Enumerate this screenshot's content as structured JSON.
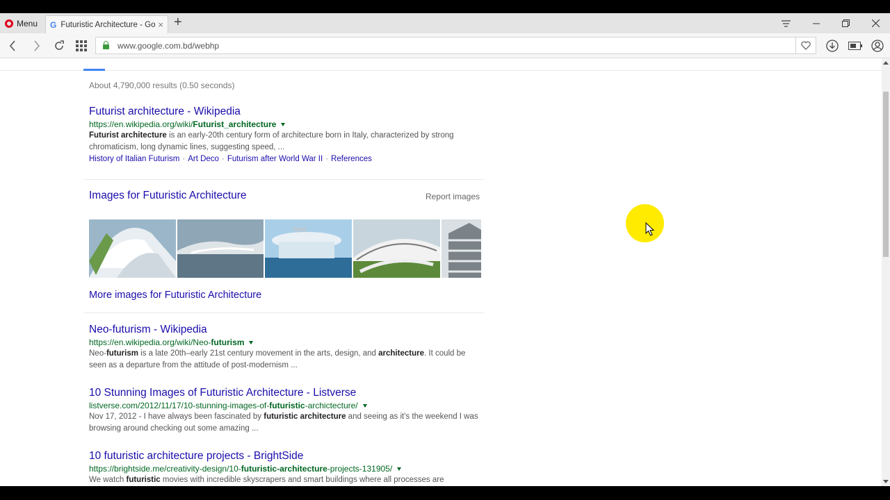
{
  "browser": {
    "menu_label": "Menu",
    "tab_title": "Futuristic Architecture - Go",
    "tab_favicon": "G",
    "tab_close": "×",
    "new_tab": "+",
    "url": "www.google.com.bd/webhp"
  },
  "stats": "About 4,790,000 results (0.50 seconds)",
  "results": [
    {
      "title": "Futurist architecture - Wikipedia",
      "url_pre": "https://en.wikipedia.org/wiki/",
      "url_bold": "Futurist_architecture",
      "url_post": "",
      "snip_bold1": "Futurist architecture",
      "snip1": " is an early-20th century form of architecture born in Italy, characterized by strong chromaticism, long dynamic lines, suggesting speed, ...",
      "sitelinks": [
        "History of Italian Futurism",
        "Art Deco",
        "Futurism after World War II",
        "References"
      ]
    },
    {
      "title": "Neo-futurism - Wikipedia",
      "url_pre": "https://en.wikipedia.org/wiki/Neo-",
      "url_bold": "futurism",
      "url_post": "",
      "snip_a": "Neo-",
      "snip_b": "futurism",
      "snip_c": " is a late 20th–early 21st century movement in the arts, design, and ",
      "snip_d": "architecture",
      "snip_e": ". It could be seen as a departure from the attitude of post-modernism ..."
    },
    {
      "title": "10 Stunning Images of Futuristic Architecture - Listverse",
      "url_pre": "listverse.com/2012/11/17/10-stunning-images-of-",
      "url_bold": "futuristic",
      "url_post": "-archictecture/",
      "snip_a": "Nov 17, 2012 - I have always been fascinated by ",
      "snip_b": "futuristic architecture",
      "snip_c": " and seeing as it's the weekend I was browsing around checking out some amazing ..."
    },
    {
      "title": "10 futuristic architecture projects - BrightSide",
      "url_pre": "https://brightside.me/creativity-design/10-",
      "url_bold": "futuristic-architecture",
      "url_post": "-projects-131905/",
      "snip_a": "We watch ",
      "snip_b": "futuristic",
      "snip_c": " movies with incredible skyscrapers and smart buildings where all processes are"
    }
  ],
  "images": {
    "title": "Images for Futuristic Architecture",
    "report": "Report images",
    "more": "More images for Futuristic Architecture"
  },
  "colors": {
    "link": "#1a0dab",
    "url_green": "#006621",
    "google_blue": "#4285f4",
    "cursor_highlight": "#ffeb00"
  }
}
